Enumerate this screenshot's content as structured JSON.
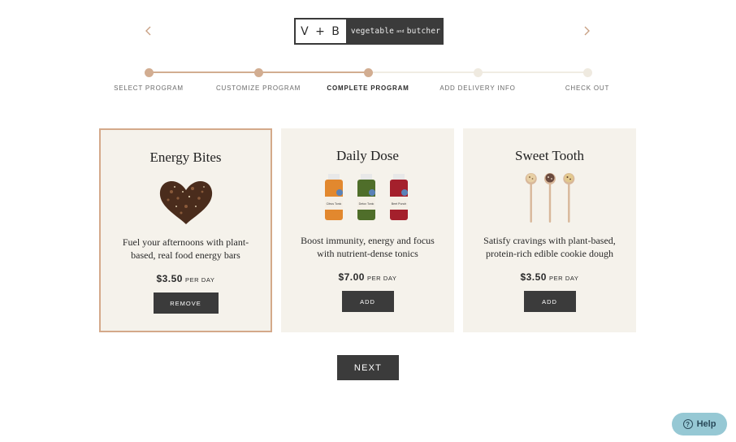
{
  "header": {
    "logo_mark": "V + B",
    "logo_word_a": "vegetable",
    "logo_word_and": "and",
    "logo_word_b": "butcher",
    "prev_icon": "chevron-left-icon",
    "next_icon": "chevron-right-icon",
    "accent_color": "#d4a98a"
  },
  "steps": [
    {
      "label": "SELECT PROGRAM",
      "state": "done"
    },
    {
      "label": "CUSTOMIZE PROGRAM",
      "state": "done"
    },
    {
      "label": "COMPLETE PROGRAM",
      "state": "current"
    },
    {
      "label": "ADD DELIVERY INFO",
      "state": "todo"
    },
    {
      "label": "CHECK OUT",
      "state": "todo"
    }
  ],
  "products": [
    {
      "title": "Energy Bites",
      "desc_1": "Fuel your afternoons with plant-",
      "desc_2": "based, real food energy bars",
      "price": "$3.50",
      "per": "PER DAY",
      "button": "REMOVE",
      "selected": true
    },
    {
      "title": "Daily Dose",
      "desc_1": "Boost immunity, energy and focus",
      "desc_2": "with nutrient-dense tonics",
      "price": "$7.00",
      "per": "PER DAY",
      "button": "ADD",
      "selected": false,
      "bottle_labels": [
        "Citrus Tonic",
        "Detox Tonic",
        "Beet Punch"
      ]
    },
    {
      "title": "Sweet Tooth",
      "desc_1": "Satisfy cravings with plant-based,",
      "desc_2": "protein-rich edible cookie dough",
      "price": "$3.50",
      "per": "PER DAY",
      "button": "ADD",
      "selected": false
    }
  ],
  "next_button": "NEXT",
  "help": {
    "label": "Help",
    "icon": "question-circle-icon",
    "color": "#96c8d4"
  }
}
